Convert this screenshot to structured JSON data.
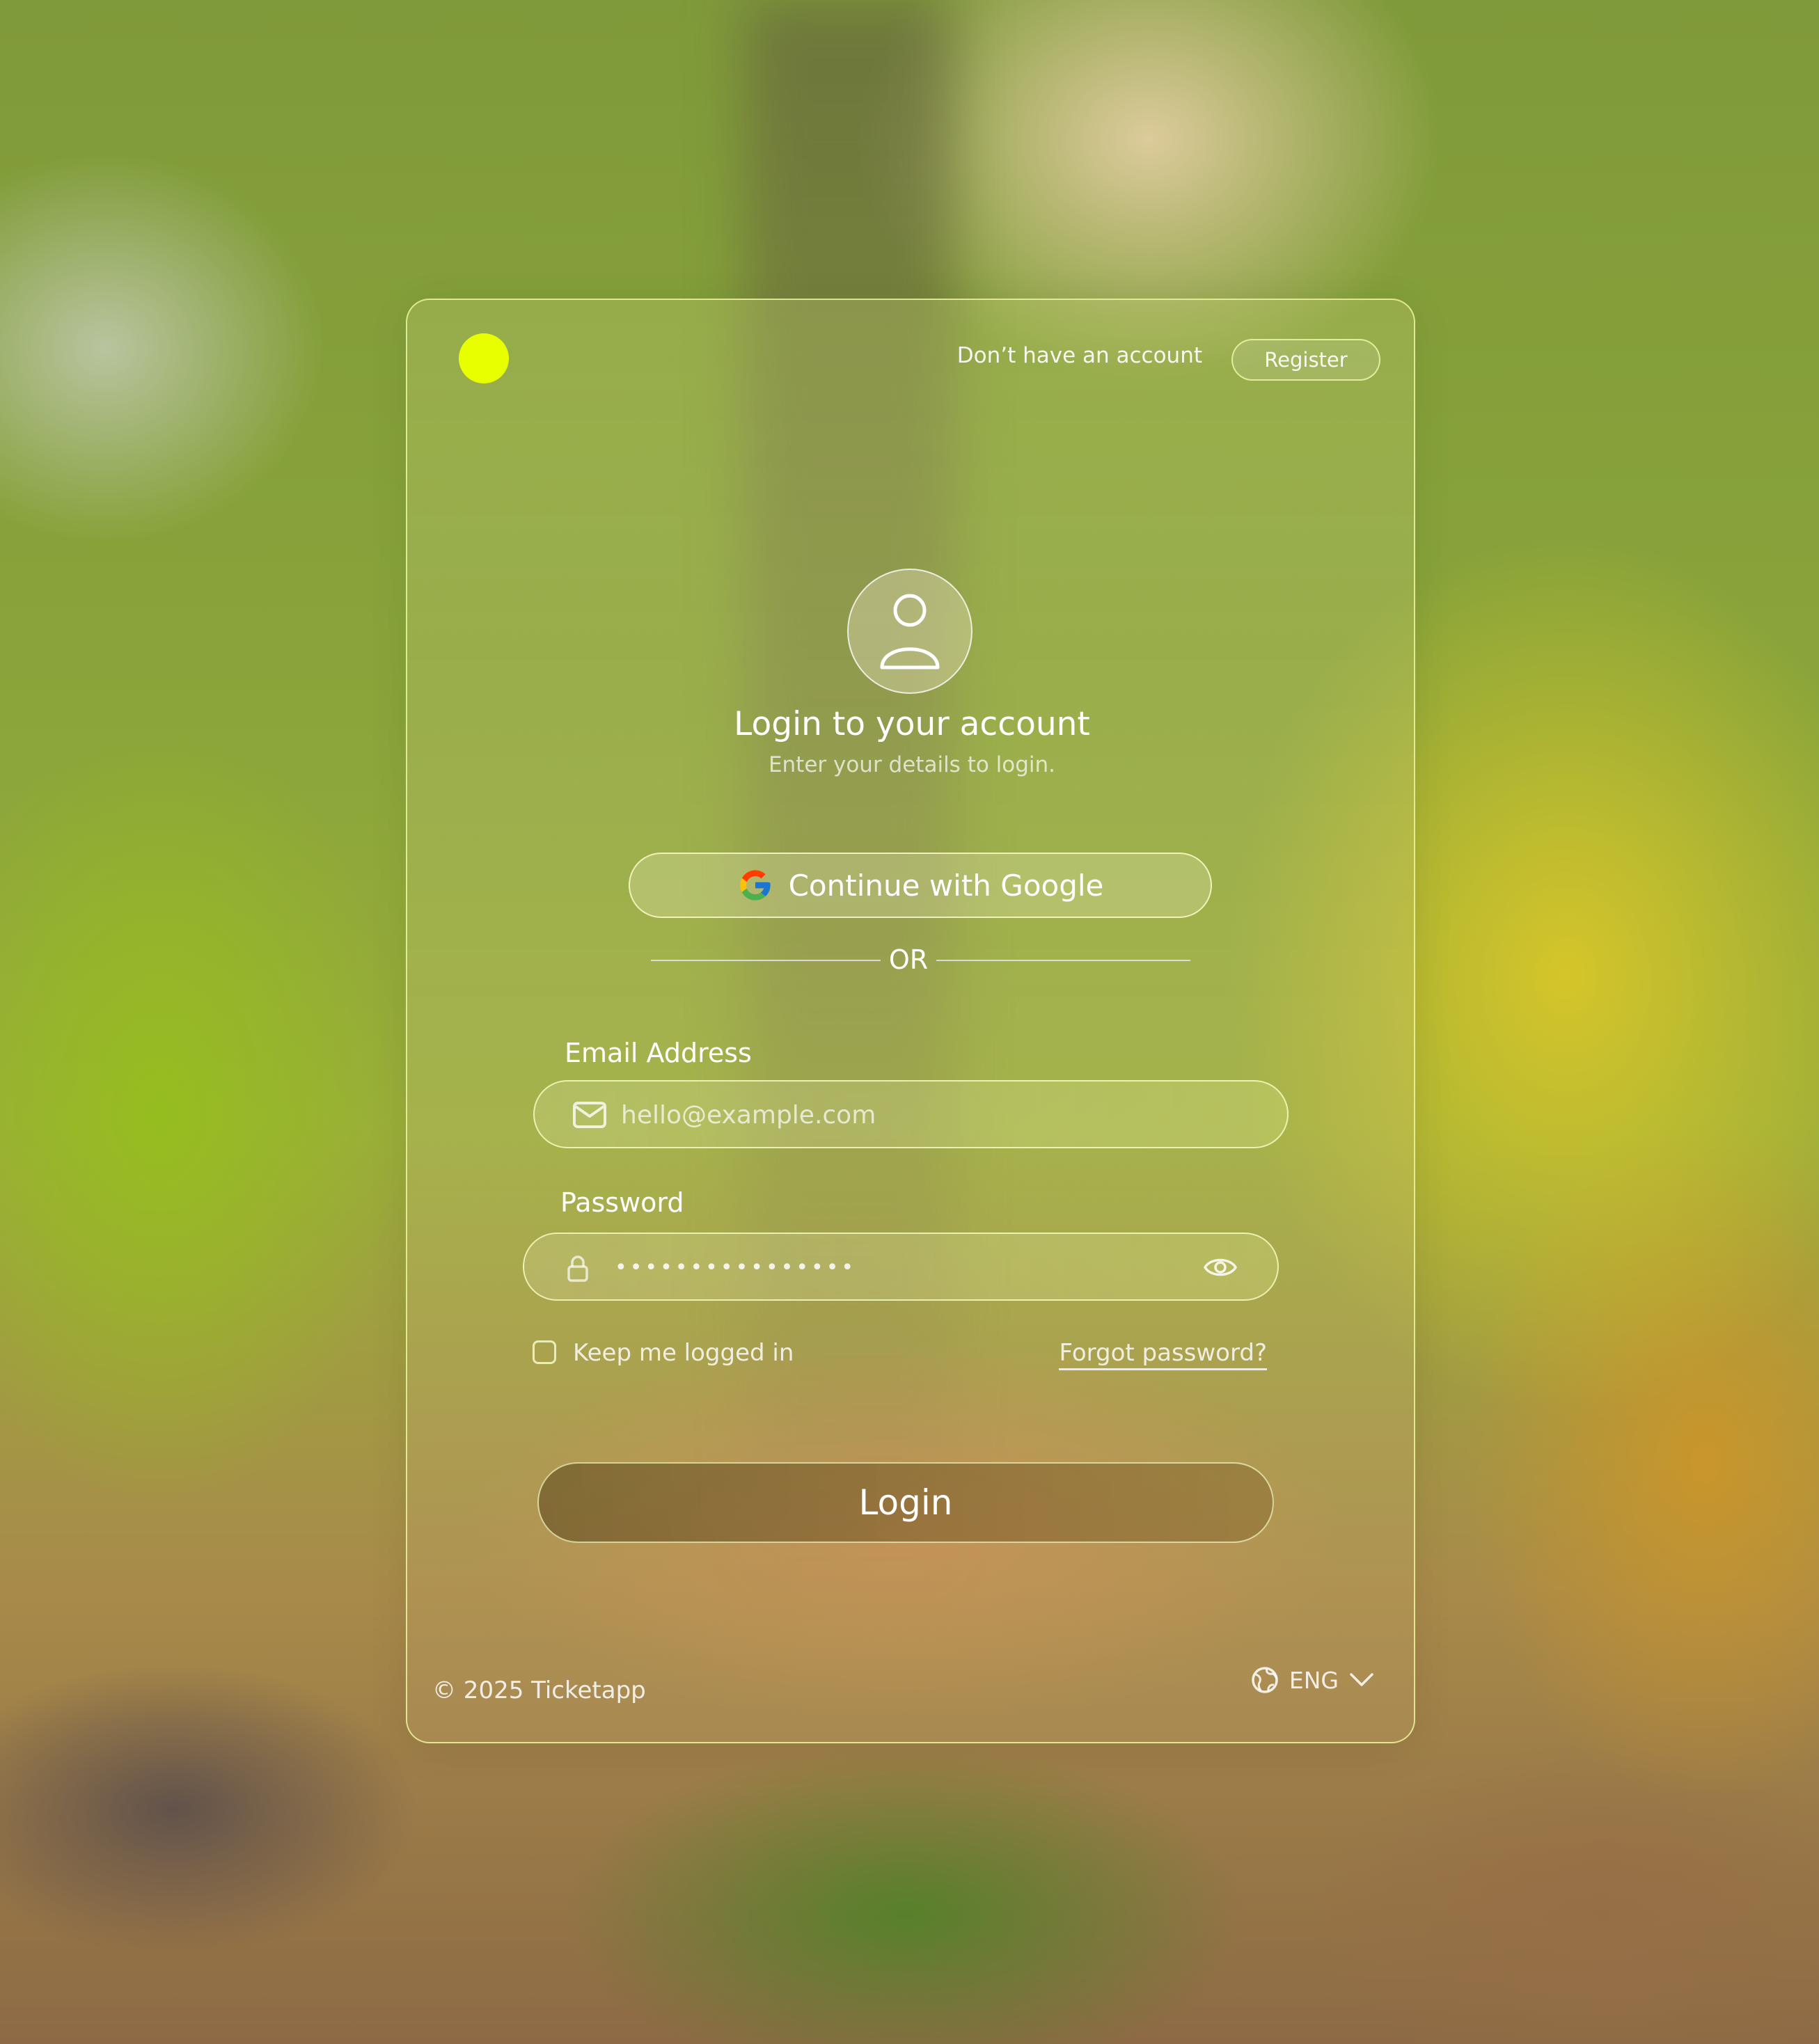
{
  "header": {
    "prompt": "Don’t have an account",
    "register_label": "Register"
  },
  "main": {
    "title": "Login to your account",
    "subtitle": "Enter your details to login.",
    "google_label": "Continue with Google",
    "divider_text": "OR"
  },
  "form": {
    "email_label": "Email Address",
    "email_placeholder": "hello@example.com",
    "password_label": "Password",
    "password_value": "••••••••••••••••",
    "keep_logged_in_label": "Keep me logged in",
    "keep_logged_in_checked": false,
    "forgot_label": "Forgot password?",
    "login_label": "Login"
  },
  "footer": {
    "copyright": "© 2025 Ticketapp",
    "language": "ENG"
  },
  "colors": {
    "accent": "#e8ff00",
    "text": "#ffffff"
  },
  "icons": [
    "user-icon",
    "google-icon",
    "mail-icon",
    "lock-icon",
    "eye-icon",
    "globe-icon",
    "chevron-down-icon"
  ]
}
